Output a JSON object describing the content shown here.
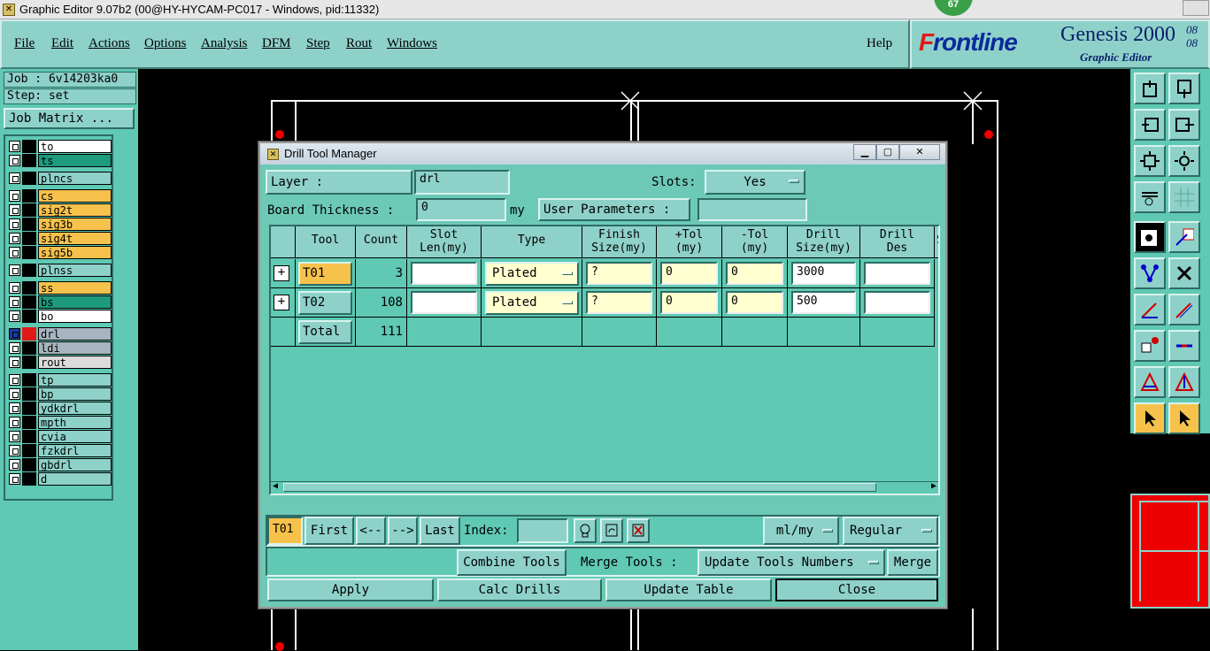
{
  "window": {
    "title": "Graphic Editor 9.07b2 (00@HY-HYCAM-PC017 - Windows, pid:11332)",
    "badge": "67"
  },
  "menu": [
    "File",
    "Edit",
    "Actions",
    "Options",
    "Analysis",
    "DFM",
    "Step",
    "Rout",
    "Windows"
  ],
  "help": "Help",
  "logo": {
    "brand_first": "F",
    "brand_rest": "rontline",
    "product": "Genesis 2000",
    "subtitle": "Graphic Editor",
    "num1": "08",
    "num2": "08"
  },
  "job": {
    "job_label": "Job : 6v14203ka0",
    "step_label": "Step: set",
    "matrix_button": "Job Matrix ..."
  },
  "layers": [
    {
      "name": "to",
      "color": "#ffffff"
    },
    {
      "name": "ts",
      "color": "#1e9a7c"
    },
    {
      "name": "plncs",
      "color": "#8ed1c9"
    },
    {
      "name": "cs",
      "color": "#f7c24c"
    },
    {
      "name": "sig2t",
      "color": "#f7c24c"
    },
    {
      "name": "sig3b",
      "color": "#f7c24c"
    },
    {
      "name": "sig4t",
      "color": "#f7c24c"
    },
    {
      "name": "sig5b",
      "color": "#f7c24c"
    },
    {
      "name": "plnss",
      "color": "#8ed1c9"
    },
    {
      "name": "ss",
      "color": "#f7c24c"
    },
    {
      "name": "bs",
      "color": "#1e9a7c"
    },
    {
      "name": "bo",
      "color": "#ffffff"
    },
    {
      "name": "drl",
      "color": "#a6b5c0"
    },
    {
      "name": "ldi",
      "color": "#a6b5c0"
    },
    {
      "name": "rout",
      "color": "#dcdcdc"
    },
    {
      "name": "tp",
      "color": "#8ed1c9"
    },
    {
      "name": "bp",
      "color": "#8ed1c9"
    },
    {
      "name": "ydkdrl",
      "color": "#8ed1c9"
    },
    {
      "name": "mpth",
      "color": "#8ed1c9"
    },
    {
      "name": "cvia",
      "color": "#8ed1c9"
    },
    {
      "name": "fzkdrl",
      "color": "#8ed1c9"
    },
    {
      "name": "gbdrl",
      "color": "#8ed1c9"
    },
    {
      "name": "d",
      "color": "#8ed1c9"
    }
  ],
  "dialog": {
    "title": "Drill Tool Manager",
    "layer_label": "Layer         :",
    "layer_value": "drl",
    "slots_label": "Slots:",
    "slots_value": "Yes",
    "board_thickness_label": "Board Thickness :",
    "board_thickness_value": "0",
    "board_thickness_unit": "my",
    "user_params_label": "User Parameters :",
    "user_params_value": "",
    "columns": [
      {
        "l1": "Tool",
        "l2": ""
      },
      {
        "l1": "Count",
        "l2": ""
      },
      {
        "l1": "Slot",
        "l2": "Len(my)"
      },
      {
        "l1": "Type",
        "l2": ""
      },
      {
        "l1": "Finish",
        "l2": "Size(my)"
      },
      {
        "l1": "+Tol",
        "l2": "(my)"
      },
      {
        "l1": "-Tol",
        "l2": "(my)"
      },
      {
        "l1": "Drill",
        "l2": "Size(my)"
      },
      {
        "l1": "Drill",
        "l2": "Des"
      },
      {
        "l1": "S",
        "l2": ""
      }
    ],
    "rows": [
      {
        "tool": "T01",
        "count": "3",
        "slot_len": "",
        "type": "Plated",
        "finish": "?",
        "plus_tol": "0",
        "minus_tol": "0",
        "drill_size": "3000",
        "drill_des": ""
      },
      {
        "tool": "T02",
        "count": "108",
        "slot_len": "",
        "type": "Plated",
        "finish": "?",
        "plus_tol": "0",
        "minus_tol": "0",
        "drill_size": "500",
        "drill_des": ""
      }
    ],
    "total_label": "Total",
    "total_count": "111",
    "current_tool": "T01",
    "nav": {
      "first": "First",
      "prev": "<--",
      "next": "-->",
      "last": "Last",
      "index_label": "Index:",
      "index_value": ""
    },
    "units_value": "ml/my",
    "mode_value": "Regular",
    "combine_tools": "Combine Tools",
    "merge_tools_label": "Merge Tools :",
    "merge_option": "Update Tools Numbers",
    "merge_button": "Merge",
    "apply": "Apply",
    "calc_drills": "Calc Drills",
    "update_table": "Update Table",
    "close": "Close"
  }
}
